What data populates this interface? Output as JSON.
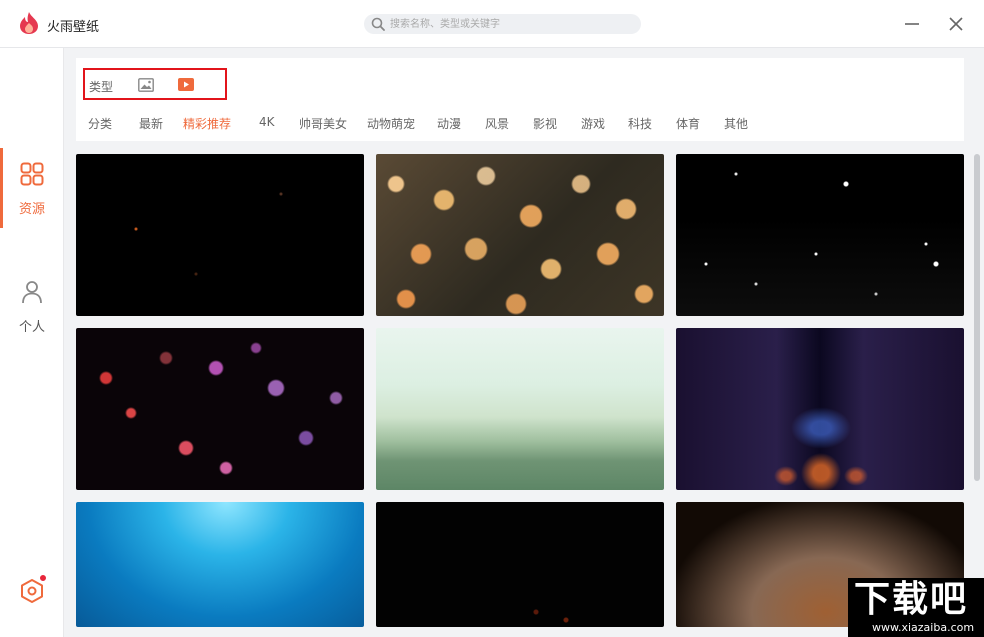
{
  "app": {
    "title": "火雨壁纸",
    "brand_color": "#ef6a3c"
  },
  "search": {
    "placeholder": "搜索名称、类型或关键字"
  },
  "sidebar": {
    "items": [
      {
        "label": "资源",
        "icon": "grid-icon",
        "active": true
      },
      {
        "label": "个人",
        "icon": "user-icon",
        "active": false
      }
    ],
    "settings_icon": "settings-icon",
    "notification_dot_color": "#e8263a"
  },
  "filters": {
    "type_label": "类型",
    "type_options": [
      "image-type-icon",
      "video-type-icon"
    ],
    "categories": [
      "分类",
      "最新",
      "精彩推荐",
      "4K",
      "帅哥美女",
      "动物萌宠",
      "动漫",
      "风景",
      "影视",
      "游戏",
      "科技",
      "体育",
      "其他"
    ],
    "active_category": "精彩推荐"
  },
  "wallpapers": [
    {
      "theme": "dark space specks"
    },
    {
      "theme": "golden bokeh lights"
    },
    {
      "theme": "falling snow particles"
    },
    {
      "theme": "purple red bokeh"
    },
    {
      "theme": "misty green horizon"
    },
    {
      "theme": "neon sci-fi corridor"
    },
    {
      "theme": "underwater light rays"
    },
    {
      "theme": "dark embers"
    },
    {
      "theme": "fiery sparks"
    }
  ],
  "watermark": {
    "main": "下载吧",
    "sub": "www.xiazaiba.com"
  }
}
